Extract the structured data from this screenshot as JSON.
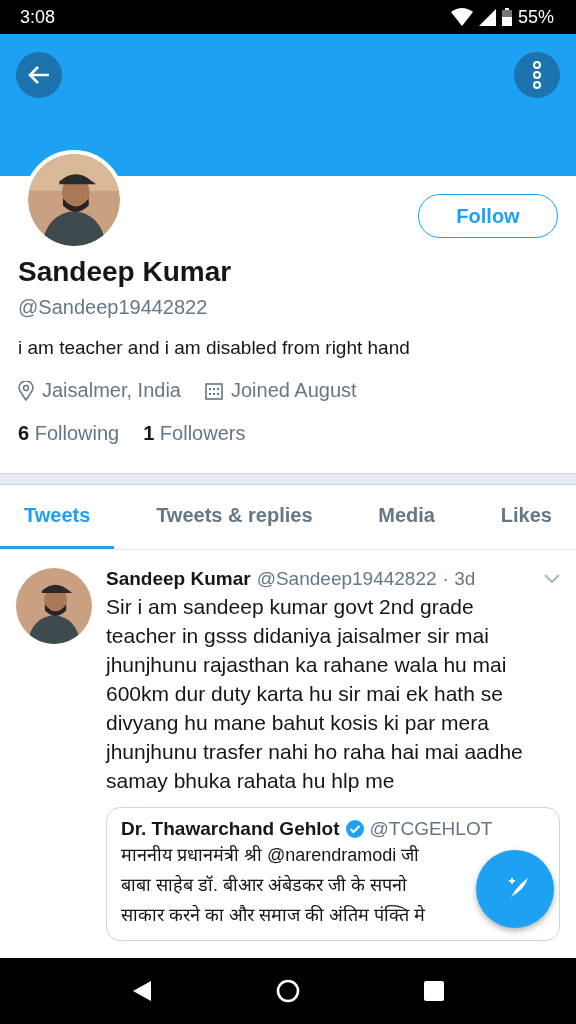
{
  "status_bar": {
    "time": "3:08",
    "battery": "55%"
  },
  "profile": {
    "name": "Sandeep Kumar",
    "handle": "@Sandeep19442822",
    "bio": "i am teacher and i am disabled from right hand",
    "location": "Jaisalmer, India",
    "joined": "Joined August",
    "following_count": "6",
    "following_label": "Following",
    "followers_count": "1",
    "followers_label": "Followers",
    "follow_button": "Follow"
  },
  "tabs": [
    {
      "label": "Tweets",
      "selected": true
    },
    {
      "label": "Tweets & replies",
      "selected": false
    },
    {
      "label": "Media",
      "selected": false
    },
    {
      "label": "Likes",
      "selected": false
    }
  ],
  "tweet": {
    "name": "Sandeep Kumar",
    "handle": "@Sandeep19442822",
    "time": "· 3d",
    "text": "Sir i am sandeep kumar govt 2nd grade teacher in gsss didaniya jaisalmer sir mai jhunjhunu rajasthan ka rahane wala hu mai 600km dur duty karta hu sir mai ek hath se divyang hu mane bahut kosis ki par mera jhunjhunu trasfer nahi ho raha hai mai aadhe samay bhuka rahata hu hlp me",
    "quote": {
      "name": "Dr. Thawarchand Gehlot",
      "verified": true,
      "handle": "@TCGEHLOT",
      "lines": [
        "माननीय प्रधानमंत्री श्री @narendramodi जी",
        "बाबा साहेब डॉ. बीआर अंबेडकर जी के सपनो",
        "साकार करने का और समाज की अंतिम पंक्ति मे"
      ]
    }
  }
}
